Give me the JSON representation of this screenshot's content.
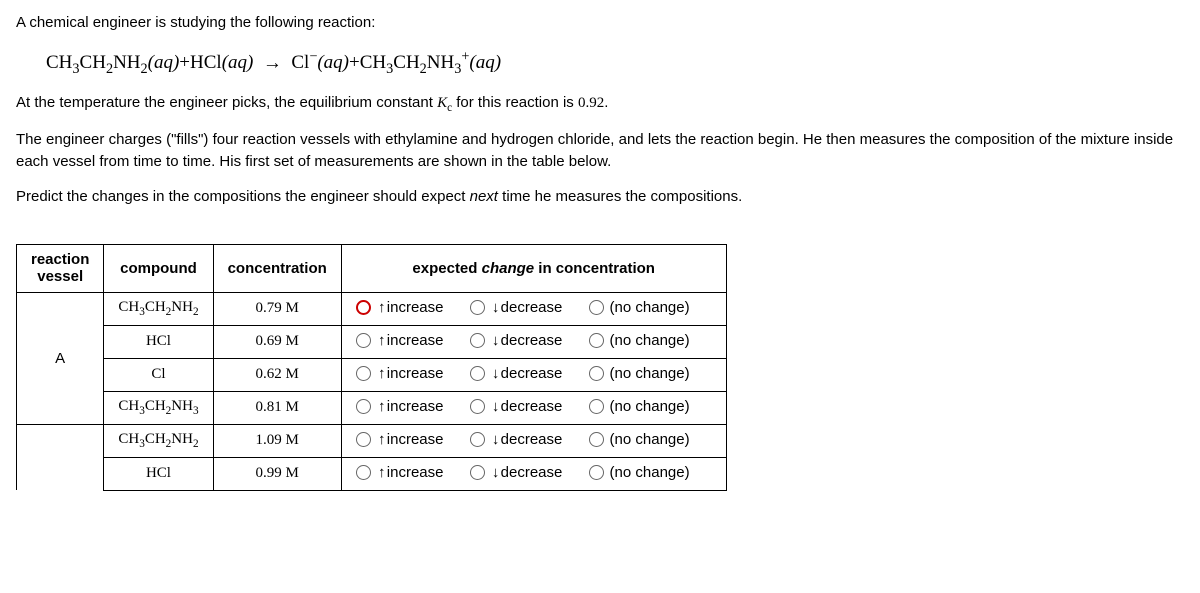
{
  "intro_line1": "A chemical engineer is studying the following reaction:",
  "equation": {
    "lhs1": "CH",
    "lhs1_s3": "3",
    "lhs2": "CH",
    "lhs2_s2": "2",
    "lhs3": "NH",
    "lhs3_s2": "2",
    "aq": "(aq)",
    "plus": "+",
    "hcl": "HCl",
    "arrow": "→",
    "cl": "Cl",
    "minus": "−",
    "rhs1": "CH",
    "rhs1_s3": "3",
    "rhs2": "CH",
    "rhs2_s2": "2",
    "rhs3": "NH",
    "rhs3_s3": "3",
    "plus_sup": "+"
  },
  "intro_line2a": "At the temperature the engineer picks, the equilibrium constant ",
  "kc": "K",
  "kc_sub": "c",
  "intro_line2b": " for this reaction is ",
  "kc_val": "0.92",
  "intro_line2c": ".",
  "para2": "The engineer charges (\"fills\") four reaction vessels with ethylamine and hydrogen chloride, and lets the reaction begin. He then measures the composition of the mixture inside each vessel from time to time. His first set of measurements are shown in the table below.",
  "para3a": "Predict the changes in the compositions the engineer should expect ",
  "para3_next": "next",
  "para3b": " time he measures the compositions.",
  "headers": {
    "vessel": "reaction vessel",
    "compound": "compound",
    "concentration": "concentration",
    "change": "expected change in concentration"
  },
  "change_italic": "change",
  "options": {
    "increase": "increase",
    "decrease": "decrease",
    "nochange": "(no change)"
  },
  "rows": [
    {
      "vessel": "A",
      "compound": "CH3CH2NH2",
      "conc": "0.79 M",
      "focus": true
    },
    {
      "vessel": "",
      "compound": "HCl",
      "conc": "0.69 M",
      "focus": false
    },
    {
      "vessel": "",
      "compound": "Cl",
      "conc": "0.62 M",
      "focus": false
    },
    {
      "vessel": "",
      "compound": "CH3CH2NH3",
      "conc": "0.81 M",
      "focus": false
    },
    {
      "vessel": "",
      "compound": "CH3CH2NH2",
      "conc": "1.09 M",
      "focus": false
    },
    {
      "vessel": "",
      "compound": "HCl",
      "conc": "0.99 M",
      "focus": false
    }
  ],
  "compound_html": {
    "CH3CH2NH2": "CH<span class='sub'>3</span>CH<span class='sub'>2</span>NH<span class='sub'>2</span>",
    "HCl": "HCl",
    "Cl": "Cl",
    "CH3CH2NH3": "CH<span class='sub'>3</span>CH<span class='sub'>2</span>NH<span class='sub'>3</span>"
  },
  "chart_data": {
    "type": "table",
    "title": "Reaction vessel compositions",
    "columns": [
      "reaction vessel",
      "compound",
      "concentration (M)"
    ],
    "rows": [
      [
        "A",
        "CH3CH2NH2",
        0.79
      ],
      [
        "A",
        "HCl",
        0.69
      ],
      [
        "A",
        "Cl",
        0.62
      ],
      [
        "A",
        "CH3CH2NH3",
        0.81
      ],
      [
        "",
        "CH3CH2NH2",
        1.09
      ],
      [
        "",
        "HCl",
        0.99
      ]
    ],
    "Kc": 0.92
  }
}
